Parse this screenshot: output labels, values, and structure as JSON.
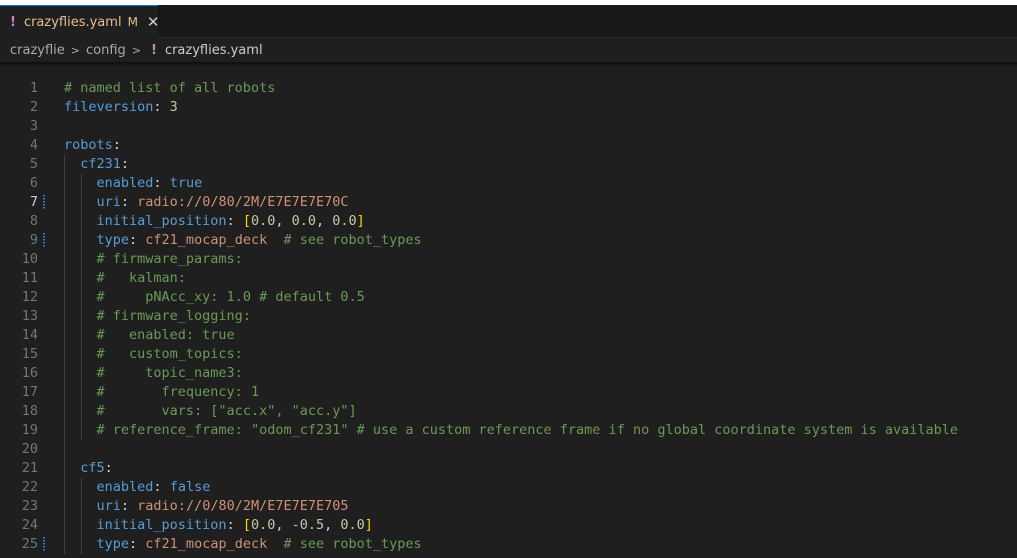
{
  "tab": {
    "icon": "yaml-icon",
    "title": "crazyflies.yaml",
    "modified": "M",
    "close": "✕"
  },
  "breadcrumb": {
    "items": [
      "crazyflie",
      "config"
    ],
    "file": "crazyflies.yaml"
  },
  "editor": {
    "active_line": 7,
    "lines": [
      {
        "n": "1",
        "s": [
          {
            "c": "cmt",
            "t": "# named list of all robots"
          }
        ]
      },
      {
        "n": "2",
        "s": [
          {
            "c": "key",
            "t": "fileversion"
          },
          {
            "c": "pun",
            "t": ": "
          },
          {
            "c": "num",
            "t": "3"
          }
        ]
      },
      {
        "n": "3",
        "s": []
      },
      {
        "n": "4",
        "s": [
          {
            "c": "key",
            "t": "robots"
          },
          {
            "c": "pun",
            "t": ":"
          }
        ]
      },
      {
        "n": "5",
        "g": 1,
        "s": [
          {
            "c": "pun",
            "t": "  "
          },
          {
            "c": "key",
            "t": "cf231"
          },
          {
            "c": "pun",
            "t": ":"
          }
        ]
      },
      {
        "n": "6",
        "g": 2,
        "s": [
          {
            "c": "pun",
            "t": "    "
          },
          {
            "c": "key",
            "t": "enabled"
          },
          {
            "c": "pun",
            "t": ": "
          },
          {
            "c": "kw",
            "t": "true"
          }
        ]
      },
      {
        "n": "7",
        "g": 2,
        "mark": true,
        "s": [
          {
            "c": "pun",
            "t": "    "
          },
          {
            "c": "key",
            "t": "uri"
          },
          {
            "c": "pun",
            "t": ": "
          },
          {
            "c": "str",
            "t": "radio://0/80/2M/E7E7E7E70C"
          }
        ]
      },
      {
        "n": "8",
        "g": 2,
        "s": [
          {
            "c": "pun",
            "t": "    "
          },
          {
            "c": "key",
            "t": "initial_position"
          },
          {
            "c": "pun",
            "t": ": "
          },
          {
            "c": "br",
            "t": "["
          },
          {
            "c": "num",
            "t": "0.0"
          },
          {
            "c": "pun",
            "t": ", "
          },
          {
            "c": "num",
            "t": "0.0"
          },
          {
            "c": "pun",
            "t": ", "
          },
          {
            "c": "num",
            "t": "0.0"
          },
          {
            "c": "br",
            "t": "]"
          }
        ]
      },
      {
        "n": "9",
        "g": 2,
        "mark": true,
        "s": [
          {
            "c": "pun",
            "t": "    "
          },
          {
            "c": "key",
            "t": "type"
          },
          {
            "c": "pun",
            "t": ": "
          },
          {
            "c": "str",
            "t": "cf21_mocap_deck"
          },
          {
            "c": "pun",
            "t": "  "
          },
          {
            "c": "cmt",
            "t": "# see robot_types"
          }
        ]
      },
      {
        "n": "10",
        "g": 2,
        "s": [
          {
            "c": "pun",
            "t": "    "
          },
          {
            "c": "cmt",
            "t": "# firmware_params:"
          }
        ]
      },
      {
        "n": "11",
        "g": 2,
        "s": [
          {
            "c": "pun",
            "t": "    "
          },
          {
            "c": "cmt",
            "t": "#   kalman:"
          }
        ]
      },
      {
        "n": "12",
        "g": 2,
        "s": [
          {
            "c": "pun",
            "t": "    "
          },
          {
            "c": "cmt",
            "t": "#     pNAcc_xy: 1.0 # default 0.5"
          }
        ]
      },
      {
        "n": "13",
        "g": 2,
        "s": [
          {
            "c": "pun",
            "t": "    "
          },
          {
            "c": "cmt",
            "t": "# firmware_logging:"
          }
        ]
      },
      {
        "n": "14",
        "g": 2,
        "s": [
          {
            "c": "pun",
            "t": "    "
          },
          {
            "c": "cmt",
            "t": "#   enabled: true"
          }
        ]
      },
      {
        "n": "15",
        "g": 2,
        "s": [
          {
            "c": "pun",
            "t": "    "
          },
          {
            "c": "cmt",
            "t": "#   custom_topics:"
          }
        ]
      },
      {
        "n": "16",
        "g": 2,
        "s": [
          {
            "c": "pun",
            "t": "    "
          },
          {
            "c": "cmt",
            "t": "#     topic_name3:"
          }
        ]
      },
      {
        "n": "17",
        "g": 2,
        "s": [
          {
            "c": "pun",
            "t": "    "
          },
          {
            "c": "cmt",
            "t": "#       frequency: 1"
          }
        ]
      },
      {
        "n": "18",
        "g": 2,
        "s": [
          {
            "c": "pun",
            "t": "    "
          },
          {
            "c": "cmt",
            "t": "#       vars: [\"acc.x\", \"acc.y\"]"
          }
        ]
      },
      {
        "n": "19",
        "g": 2,
        "s": [
          {
            "c": "pun",
            "t": "    "
          },
          {
            "c": "cmt",
            "t": "# reference_frame: \"odom_cf231\" # use a custom reference frame if no global coordinate system is available"
          }
        ]
      },
      {
        "n": "20",
        "g": 1,
        "s": []
      },
      {
        "n": "21",
        "g": 1,
        "s": [
          {
            "c": "pun",
            "t": "  "
          },
          {
            "c": "key",
            "t": "cf5"
          },
          {
            "c": "pun",
            "t": ":"
          }
        ]
      },
      {
        "n": "22",
        "g": 2,
        "s": [
          {
            "c": "pun",
            "t": "    "
          },
          {
            "c": "key",
            "t": "enabled"
          },
          {
            "c": "pun",
            "t": ": "
          },
          {
            "c": "kw",
            "t": "false"
          }
        ]
      },
      {
        "n": "23",
        "g": 2,
        "s": [
          {
            "c": "pun",
            "t": "    "
          },
          {
            "c": "key",
            "t": "uri"
          },
          {
            "c": "pun",
            "t": ": "
          },
          {
            "c": "str",
            "t": "radio://0/80/2M/E7E7E7E705"
          }
        ]
      },
      {
        "n": "24",
        "g": 2,
        "s": [
          {
            "c": "pun",
            "t": "    "
          },
          {
            "c": "key",
            "t": "initial_position"
          },
          {
            "c": "pun",
            "t": ": "
          },
          {
            "c": "br",
            "t": "["
          },
          {
            "c": "num",
            "t": "0.0"
          },
          {
            "c": "pun",
            "t": ", "
          },
          {
            "c": "num",
            "t": "-0.5"
          },
          {
            "c": "pun",
            "t": ", "
          },
          {
            "c": "num",
            "t": "0.0"
          },
          {
            "c": "br",
            "t": "]"
          }
        ]
      },
      {
        "n": "25",
        "g": 2,
        "mark": true,
        "s": [
          {
            "c": "pun",
            "t": "    "
          },
          {
            "c": "key",
            "t": "type"
          },
          {
            "c": "pun",
            "t": ": "
          },
          {
            "c": "str",
            "t": "cf21_mocap_deck"
          },
          {
            "c": "pun",
            "t": "  "
          },
          {
            "c": "cmt",
            "t": "# see robot_types"
          }
        ]
      }
    ]
  }
}
